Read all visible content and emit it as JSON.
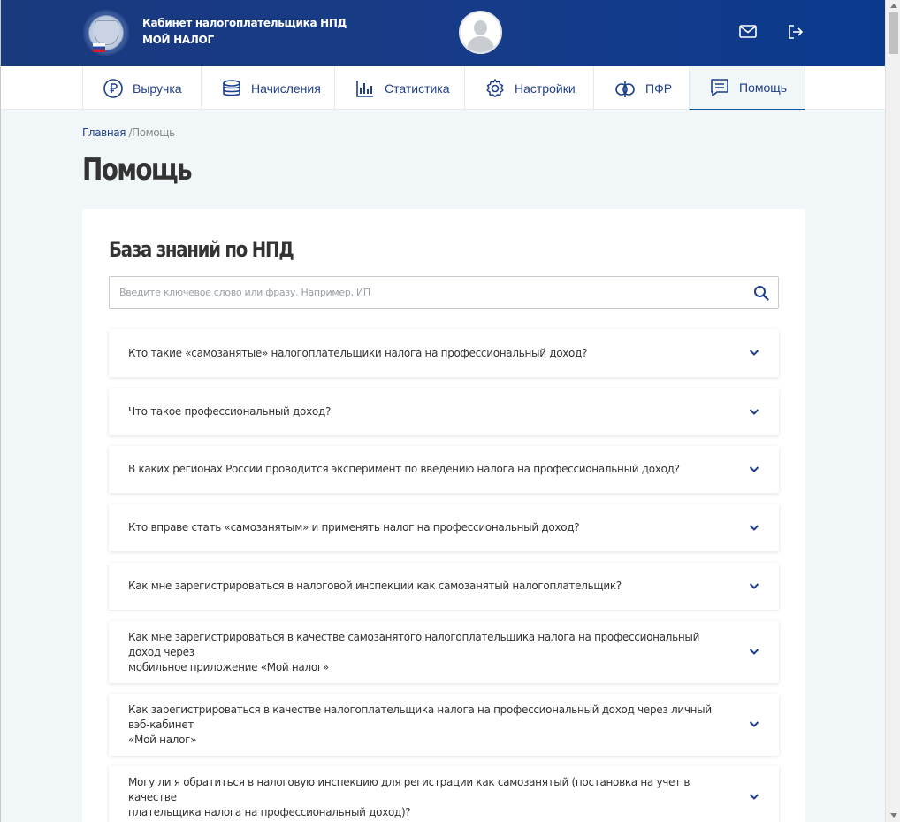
{
  "header": {
    "title_line1": "Кабинет налогоплательщика НПД",
    "title_line2": "МОЙ НАЛОГ",
    "colors": {
      "header_bg": "#1a3a7e",
      "accent": "#1e3f8b"
    },
    "icons": {
      "mail": "mail-icon",
      "logout": "logout-icon"
    }
  },
  "nav": {
    "items": [
      {
        "label": "Выручка",
        "icon": "ruble-icon"
      },
      {
        "label": "Начисления",
        "icon": "coins-icon"
      },
      {
        "label": "Статистика",
        "icon": "bar-chart-icon"
      },
      {
        "label": "Настройки",
        "icon": "gear-icon"
      },
      {
        "label": "ПФР",
        "icon": "pfr-icon"
      },
      {
        "label": "Помощь",
        "icon": "help-doc-icon",
        "active": true
      }
    ]
  },
  "breadcrumb": {
    "home": "Главная",
    "separator": " /",
    "current": "Помощь"
  },
  "page": {
    "title": "Помощь"
  },
  "knowledge_base": {
    "title": "База знаний по НПД",
    "search_placeholder": "Введите ключевое слово или фразу. Например, ИП",
    "search_value": ""
  },
  "faq": [
    {
      "line1": "Кто такие «самозанятые» налогоплательщики налога на профессиональный доход?",
      "line2": ""
    },
    {
      "line1": "Что такое профессиональный доход?",
      "line2": ""
    },
    {
      "line1": "В каких регионах России проводится эксперимент по введению налога на профессиональный доход?",
      "line2": ""
    },
    {
      "line1": "Кто вправе стать «самозанятым» и применять налог на профессиональный доход?",
      "line2": ""
    },
    {
      "line1": "Как мне зарегистрироваться в налоговой инспекции как самозанятый налогоплательщик?",
      "line2": ""
    },
    {
      "line1": "Как мне зарегистрироваться в качестве самозанятого налогоплательщика налога на профессиональный доход через",
      "line2": "мобильное приложение «Мой налог»"
    },
    {
      "line1": "Как зарегистрироваться в качестве налогоплательщика налога на профессиональный доход через личный вэб-кабинет",
      "line2": "«Мой налог»"
    },
    {
      "line1": "Могу ли я обратиться в налоговую инспекцию для регистрации как самозанятый (постановка на учет в качестве",
      "line2": "плательщика налога на профессиональный доход)?"
    }
  ]
}
